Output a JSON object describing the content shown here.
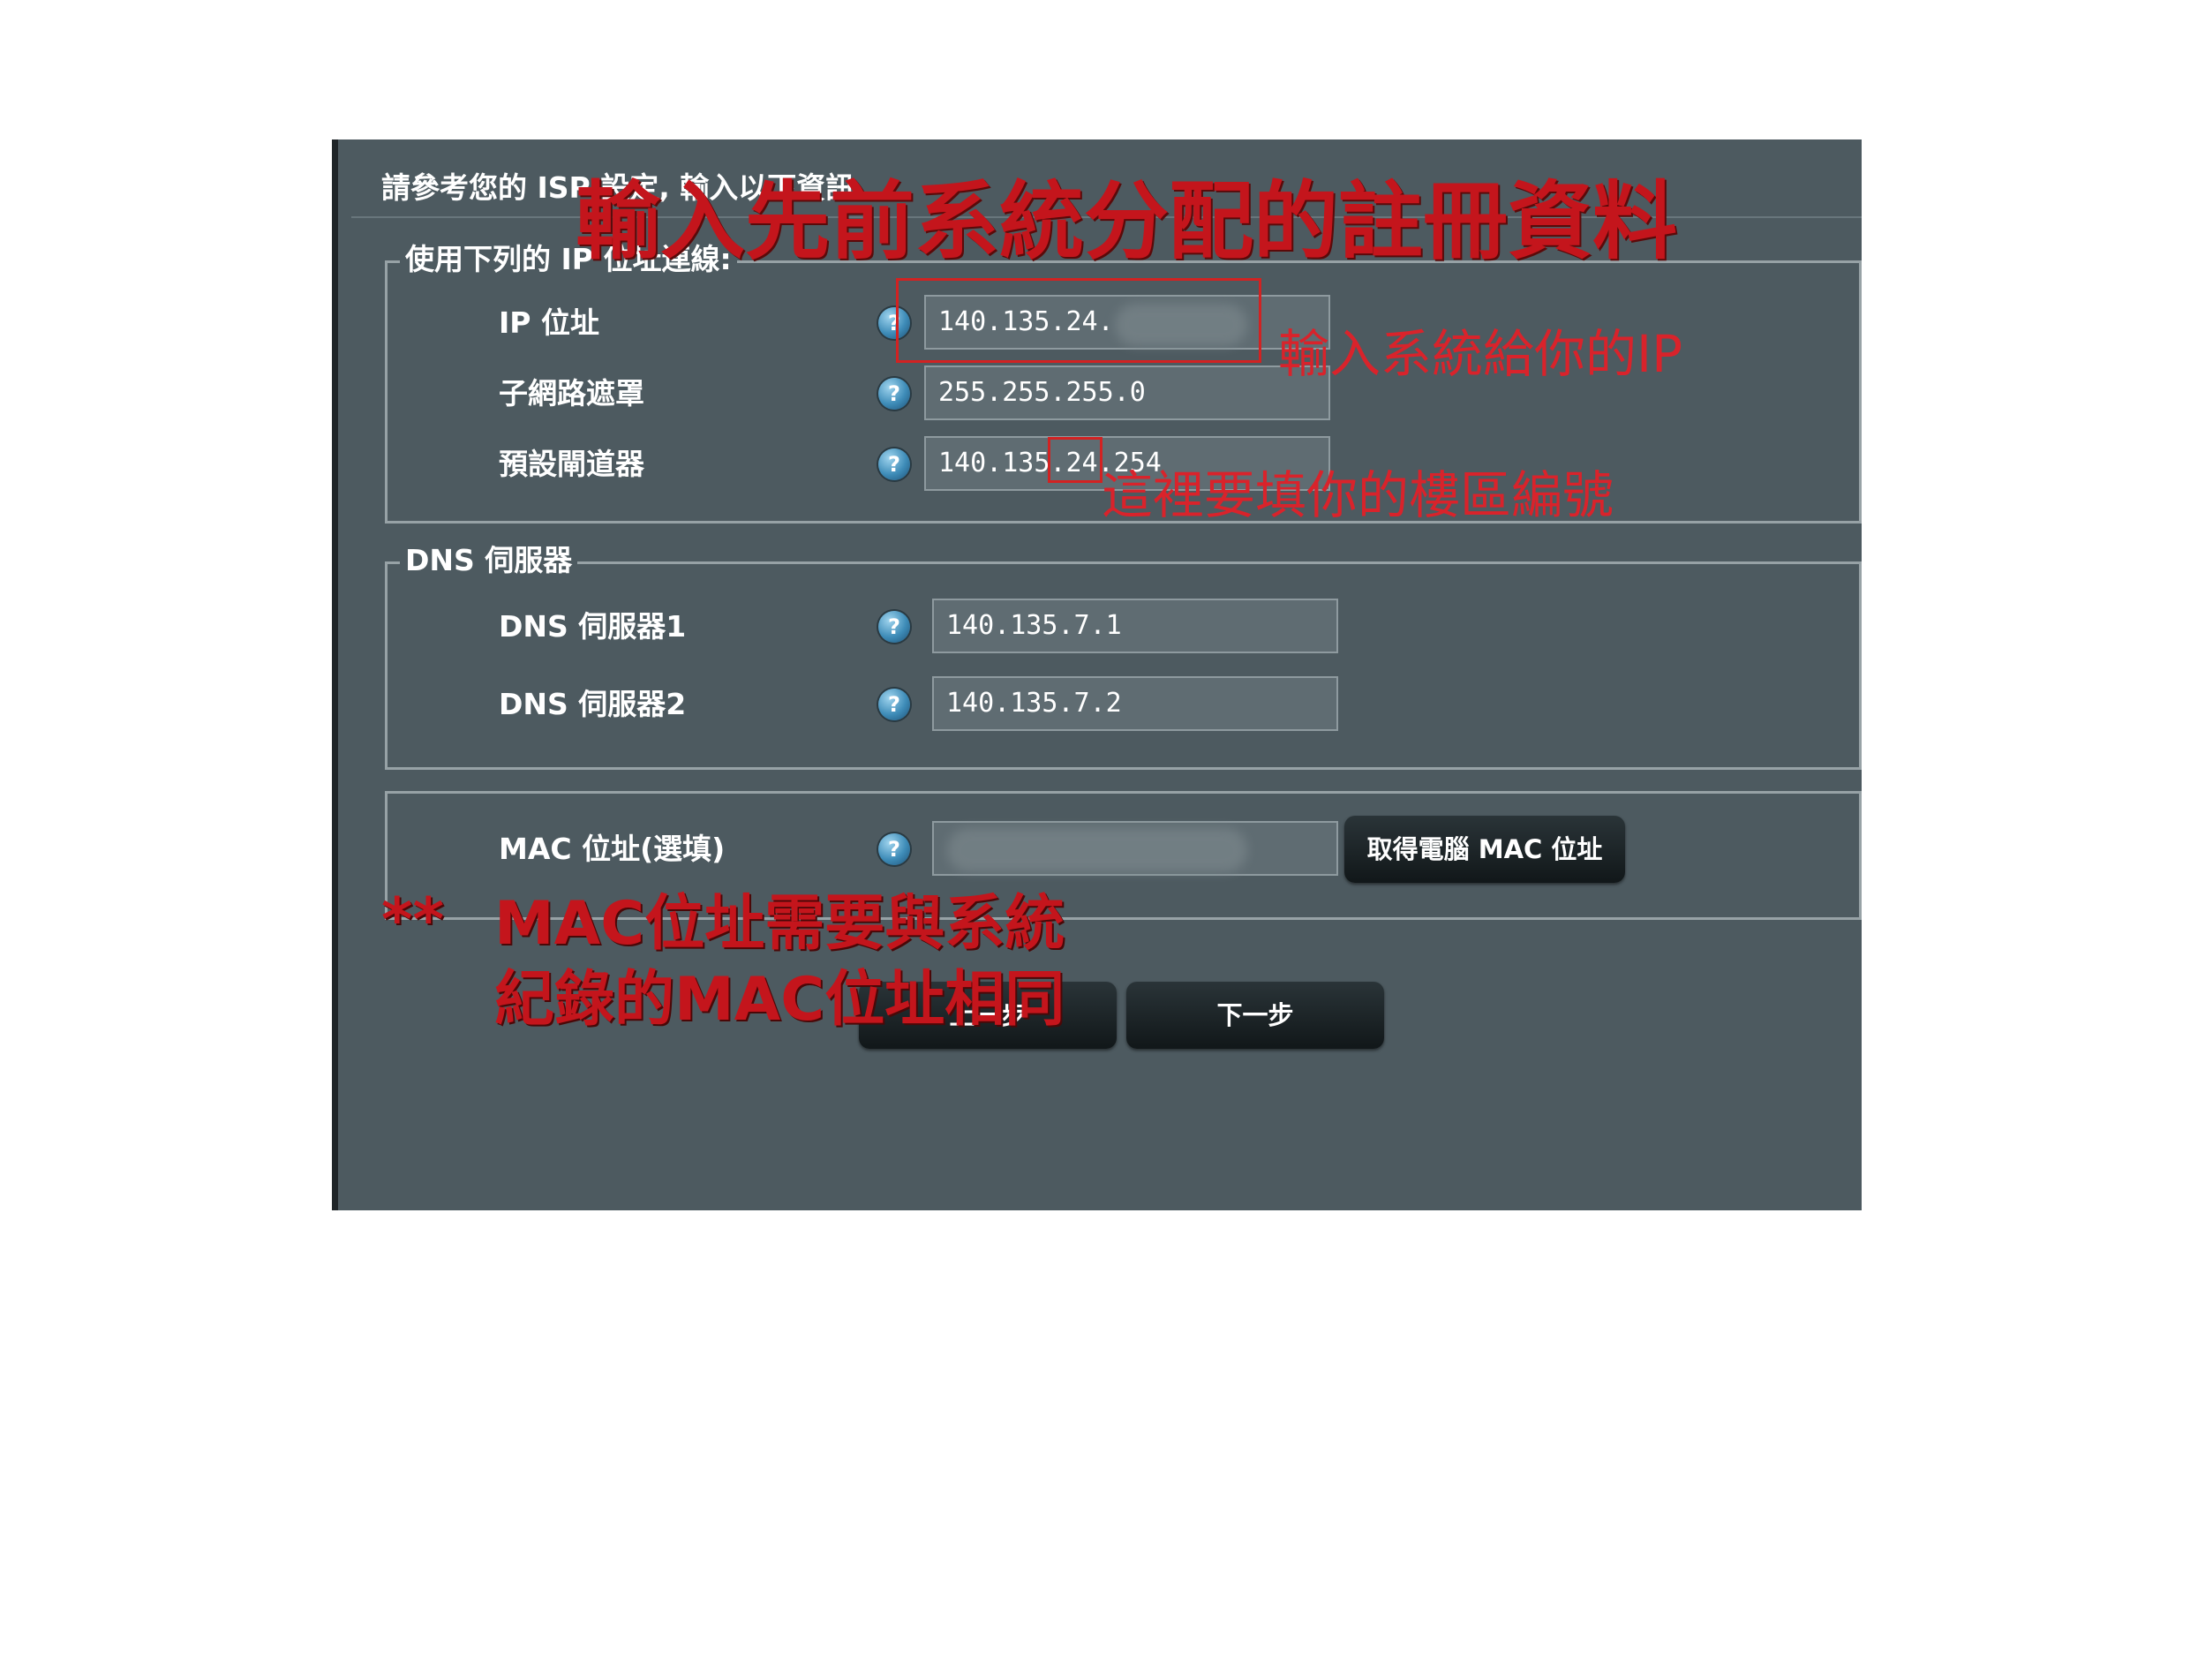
{
  "header": {
    "instruction": "請參考您的 ISP 設定, 輸入以下資訊"
  },
  "static_ip": {
    "legend": "使用下列的 IP 位址連線:",
    "ip_label": "IP 位址",
    "ip_value": "140.135.24.",
    "subnet_label": "子網路遮罩",
    "subnet_value": "255.255.255.0",
    "gateway_label": "預設閘道器",
    "gateway_value": "140.135.24.254"
  },
  "dns": {
    "legend": "DNS 伺服器",
    "dns1_label": "DNS 伺服器1",
    "dns1_value": "140.135.7.1",
    "dns2_label": "DNS 伺服器2",
    "dns2_value": "140.135.7.2"
  },
  "mac": {
    "label": "MAC 位址(選填)",
    "value": "",
    "get_mac_button": "取得電腦 MAC 位址"
  },
  "nav": {
    "prev_button": "上一步",
    "next_button": "下一步"
  },
  "help_icon_glyph": "?",
  "annotations": {
    "title": "輸入先前系統分配的註冊資料",
    "ip_note": "輸入系統給你的IP",
    "gateway_note": "這裡要填你的樓區編號",
    "mac_note_stars": "**",
    "mac_note_line1": "MAC位址需要與系統",
    "mac_note_line2": "紀錄的MAC位址相同"
  },
  "colors": {
    "panel_bg": "#4d5a60",
    "annotation_red": "#c4151c",
    "button_dark": "#111719",
    "help_icon_blue": "#3e8cb8"
  },
  "icons": [
    "help-icon"
  ]
}
